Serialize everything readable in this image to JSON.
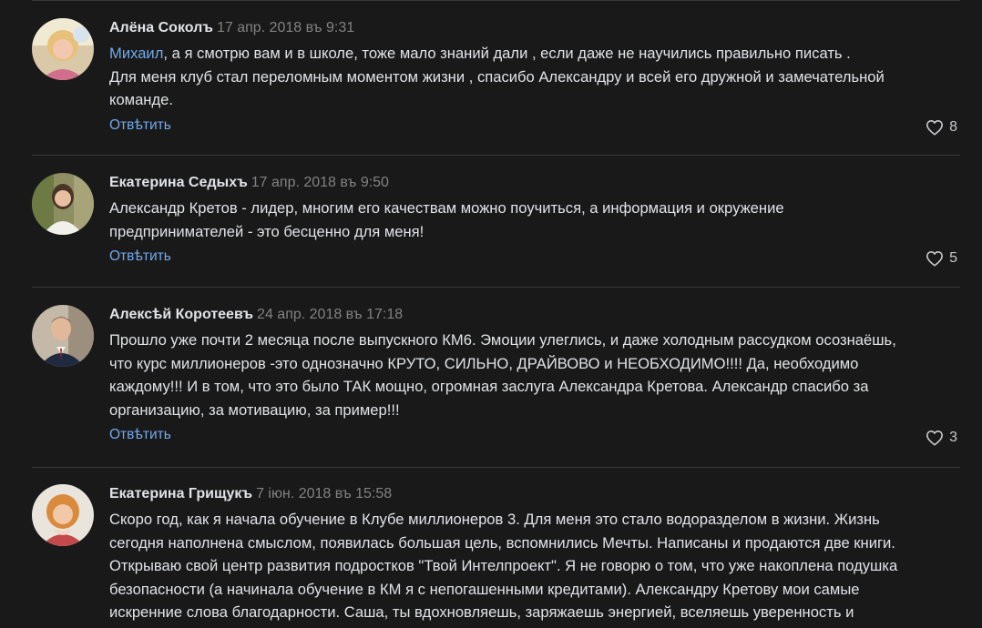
{
  "comments": [
    {
      "author": "Алёна Соколъ",
      "date": "17 апр. 2018 въ 9:31",
      "mention": "Михаил",
      "lines": [
        ", а я смотрю вам и в школе, тоже мало знаний дали , если даже не научились правильно писать .",
        "Для меня клуб стал переломным моментом жизни , спасибо Александру и всей его дружной и замечательной",
        "команде."
      ],
      "reply_label": "Отвѣтить",
      "likes": "8"
    },
    {
      "author": "Екатерина Седыхъ",
      "date": "17 апр. 2018 въ 9:50",
      "lines": [
        "Александр Кретов - лидер, многим его качествам можно поучиться, а информация и окружение",
        "предпринимателей - это бесценно для меня!"
      ],
      "reply_label": "Отвѣтить",
      "likes": "5"
    },
    {
      "author": "Алексѣй Коротеевъ",
      "date": "24 апр. 2018 въ 17:18",
      "lines": [
        "Прошло уже почти 2 месяца после выпускного КМ6. Эмоции улеглись, и даже холодным рассудком осознаёшь,",
        "что курс миллионеров -это однозначно КРУТО, СИЛЬНО, ДРАЙВОВО и НЕОБХОДИМО!!!! Да, необходимо",
        "каждому!!! И в том, что это было ТАК мощно, огромная заслуга Александра Кретова. Александр спасибо за",
        "организацию, за мотивацию, за пример!!!"
      ],
      "reply_label": "Отвѣтить",
      "likes": "3"
    },
    {
      "author": "Екатерина Грищукъ",
      "date": "7 iюн. 2018 въ 15:58",
      "lines": [
        "Скоро год, как я начала обучение в Клубе миллионеров 3. Для меня это стало водоразделом в жизни. Жизнь",
        "сегодня наполнена смыслом, появилась большая цель, вспомнились Мечты. Написаны и продаются две книги.",
        "Открываю свой центр развития подростков \"Твой Интелпроект\". Я не говорю о том, что уже накоплена подушка",
        "безопасности (а начинала обучение в КМ я с непогашенными кредитами). Александру Кретову мои самые",
        "искренние слова благодарности. Саша, ты вдохновляешь, заряжаешь энергией, вселяешь уверенность и"
      ]
    }
  ],
  "colors": {
    "background": "#19191a",
    "text": "#e1e3e6",
    "muted": "#828282",
    "link": "#71aaeb",
    "divider": "#363738"
  },
  "icons": {
    "like": "heart-outline-icon"
  }
}
